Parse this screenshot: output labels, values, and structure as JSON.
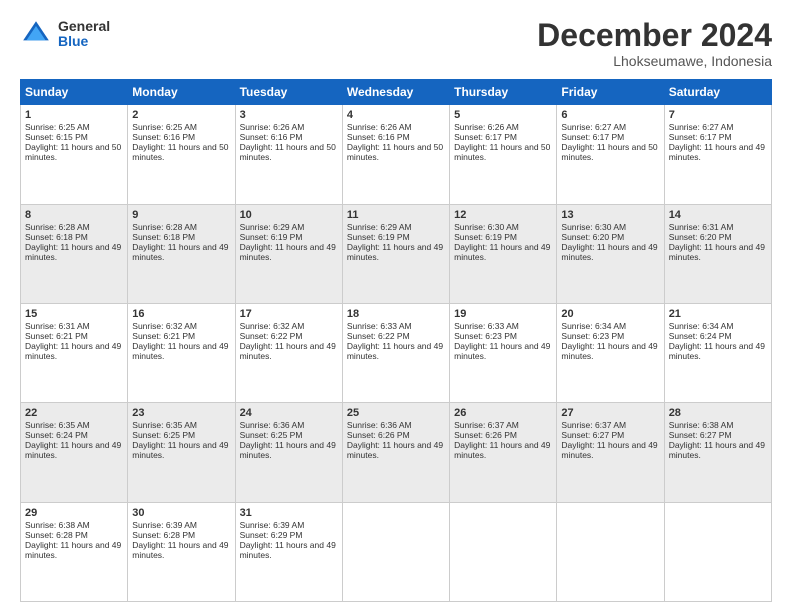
{
  "logo": {
    "general": "General",
    "blue": "Blue"
  },
  "header": {
    "month": "December 2024",
    "location": "Lhokseumawe, Indonesia"
  },
  "weekdays": [
    "Sunday",
    "Monday",
    "Tuesday",
    "Wednesday",
    "Thursday",
    "Friday",
    "Saturday"
  ],
  "weeks": [
    [
      {
        "day": 1,
        "sunrise": "6:25 AM",
        "sunset": "6:15 PM",
        "daylight": "11 hours and 50 minutes."
      },
      {
        "day": 2,
        "sunrise": "6:25 AM",
        "sunset": "6:16 PM",
        "daylight": "11 hours and 50 minutes."
      },
      {
        "day": 3,
        "sunrise": "6:26 AM",
        "sunset": "6:16 PM",
        "daylight": "11 hours and 50 minutes."
      },
      {
        "day": 4,
        "sunrise": "6:26 AM",
        "sunset": "6:16 PM",
        "daylight": "11 hours and 50 minutes."
      },
      {
        "day": 5,
        "sunrise": "6:26 AM",
        "sunset": "6:17 PM",
        "daylight": "11 hours and 50 minutes."
      },
      {
        "day": 6,
        "sunrise": "6:27 AM",
        "sunset": "6:17 PM",
        "daylight": "11 hours and 50 minutes."
      },
      {
        "day": 7,
        "sunrise": "6:27 AM",
        "sunset": "6:17 PM",
        "daylight": "11 hours and 49 minutes."
      }
    ],
    [
      {
        "day": 8,
        "sunrise": "6:28 AM",
        "sunset": "6:18 PM",
        "daylight": "11 hours and 49 minutes."
      },
      {
        "day": 9,
        "sunrise": "6:28 AM",
        "sunset": "6:18 PM",
        "daylight": "11 hours and 49 minutes."
      },
      {
        "day": 10,
        "sunrise": "6:29 AM",
        "sunset": "6:19 PM",
        "daylight": "11 hours and 49 minutes."
      },
      {
        "day": 11,
        "sunrise": "6:29 AM",
        "sunset": "6:19 PM",
        "daylight": "11 hours and 49 minutes."
      },
      {
        "day": 12,
        "sunrise": "6:30 AM",
        "sunset": "6:19 PM",
        "daylight": "11 hours and 49 minutes."
      },
      {
        "day": 13,
        "sunrise": "6:30 AM",
        "sunset": "6:20 PM",
        "daylight": "11 hours and 49 minutes."
      },
      {
        "day": 14,
        "sunrise": "6:31 AM",
        "sunset": "6:20 PM",
        "daylight": "11 hours and 49 minutes."
      }
    ],
    [
      {
        "day": 15,
        "sunrise": "6:31 AM",
        "sunset": "6:21 PM",
        "daylight": "11 hours and 49 minutes."
      },
      {
        "day": 16,
        "sunrise": "6:32 AM",
        "sunset": "6:21 PM",
        "daylight": "11 hours and 49 minutes."
      },
      {
        "day": 17,
        "sunrise": "6:32 AM",
        "sunset": "6:22 PM",
        "daylight": "11 hours and 49 minutes."
      },
      {
        "day": 18,
        "sunrise": "6:33 AM",
        "sunset": "6:22 PM",
        "daylight": "11 hours and 49 minutes."
      },
      {
        "day": 19,
        "sunrise": "6:33 AM",
        "sunset": "6:23 PM",
        "daylight": "11 hours and 49 minutes."
      },
      {
        "day": 20,
        "sunrise": "6:34 AM",
        "sunset": "6:23 PM",
        "daylight": "11 hours and 49 minutes."
      },
      {
        "day": 21,
        "sunrise": "6:34 AM",
        "sunset": "6:24 PM",
        "daylight": "11 hours and 49 minutes."
      }
    ],
    [
      {
        "day": 22,
        "sunrise": "6:35 AM",
        "sunset": "6:24 PM",
        "daylight": "11 hours and 49 minutes."
      },
      {
        "day": 23,
        "sunrise": "6:35 AM",
        "sunset": "6:25 PM",
        "daylight": "11 hours and 49 minutes."
      },
      {
        "day": 24,
        "sunrise": "6:36 AM",
        "sunset": "6:25 PM",
        "daylight": "11 hours and 49 minutes."
      },
      {
        "day": 25,
        "sunrise": "6:36 AM",
        "sunset": "6:26 PM",
        "daylight": "11 hours and 49 minutes."
      },
      {
        "day": 26,
        "sunrise": "6:37 AM",
        "sunset": "6:26 PM",
        "daylight": "11 hours and 49 minutes."
      },
      {
        "day": 27,
        "sunrise": "6:37 AM",
        "sunset": "6:27 PM",
        "daylight": "11 hours and 49 minutes."
      },
      {
        "day": 28,
        "sunrise": "6:38 AM",
        "sunset": "6:27 PM",
        "daylight": "11 hours and 49 minutes."
      }
    ],
    [
      {
        "day": 29,
        "sunrise": "6:38 AM",
        "sunset": "6:28 PM",
        "daylight": "11 hours and 49 minutes."
      },
      {
        "day": 30,
        "sunrise": "6:39 AM",
        "sunset": "6:28 PM",
        "daylight": "11 hours and 49 minutes."
      },
      {
        "day": 31,
        "sunrise": "6:39 AM",
        "sunset": "6:29 PM",
        "daylight": "11 hours and 49 minutes."
      },
      null,
      null,
      null,
      null
    ]
  ]
}
